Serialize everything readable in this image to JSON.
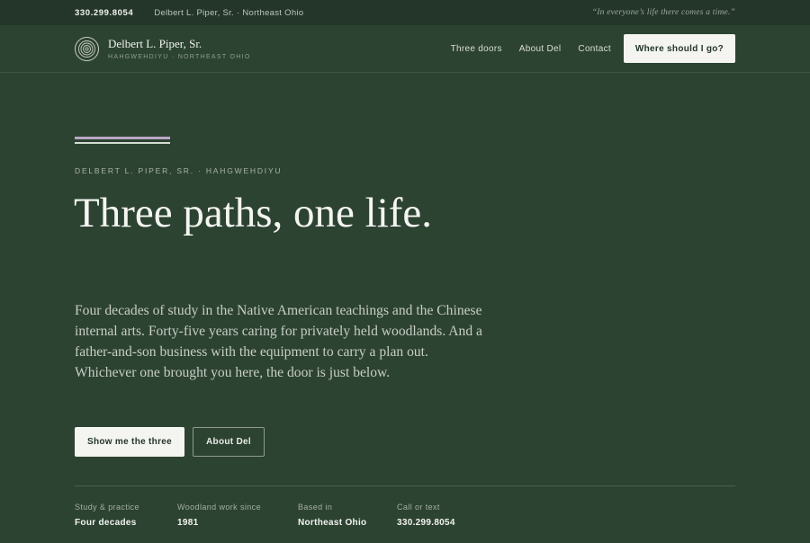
{
  "topbar": {
    "phone": "330.299.8054",
    "location": "Delbert L. Piper, Sr. · Northeast Ohio",
    "quote": "“In everyone’s life there comes a time.”"
  },
  "nav": {
    "brand_name": "Delbert L. Piper, Sr.",
    "brand_sub": "HAHGWEHDIYU · NORTHEAST OHIO",
    "logo_icon": "concentric-rings-icon",
    "links": [
      "Three doors",
      "About Del",
      "Contact"
    ],
    "cta": "Where should I go?"
  },
  "hero": {
    "eyebrow": "DELBERT L. PIPER, SR. · HAHGWEHDIYU",
    "headline": "Three paths, one life.",
    "lede": "Four decades of study in the Native American teachings and the Chinese internal arts. Forty-five years caring for privately held woodlands. And a father-and-son business with the equipment to carry a plan out. Whichever one brought you here, the door is just below.",
    "primary_button": "Show me the three",
    "secondary_button": "About Del"
  },
  "stats": [
    {
      "label": "Study & practice",
      "value": "Four decades"
    },
    {
      "label": "Woodland work since",
      "value": "1981"
    },
    {
      "label": "Based in",
      "value": "Northeast Ohio"
    },
    {
      "label": "Call or text",
      "value": "330.299.8054"
    }
  ],
  "colors": {
    "background": "#2d4332",
    "topbar": "#24352a",
    "accent_lavender": "#b8a8c6",
    "button_light": "#f4f5f1"
  }
}
